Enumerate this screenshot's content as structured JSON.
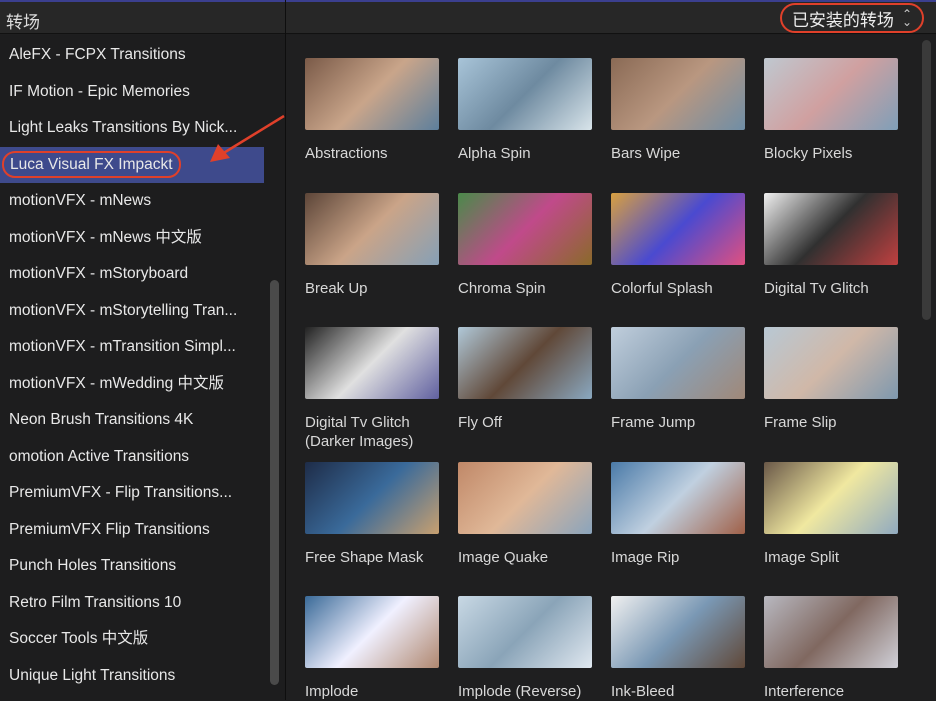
{
  "header": {
    "title": "转场",
    "filter": "已安装的转场"
  },
  "sidebar": {
    "items": [
      "AleFX - FCPX Transitions",
      "IF Motion - Epic Memories",
      "Light Leaks Transitions By Nick...",
      "Luca Visual FX Impackt",
      "motionVFX - mNews",
      "motionVFX - mNews 中文版",
      "motionVFX - mStoryboard",
      "motionVFX - mStorytelling Tran...",
      "motionVFX - mTransition Simpl...",
      "motionVFX - mWedding 中文版",
      "Neon Brush Transitions 4K",
      "omotion Active Transitions",
      "PremiumVFX - Flip Transitions...",
      "PremiumVFX Flip Transitions",
      "Punch Holes Transitions",
      "Retro Film Transitions 10",
      "Soccer Tools 中文版",
      "Unique Light Transitions"
    ],
    "selected_index": 3
  },
  "transitions": [
    {
      "name": "Abstractions",
      "colors": [
        "#7a5a48",
        "#c9a58a",
        "#5d7f9c"
      ]
    },
    {
      "name": "Alpha Spin",
      "colors": [
        "#a8c4d8",
        "#6e8aa0",
        "#d8e4ea"
      ]
    },
    {
      "name": "Bars Wipe",
      "colors": [
        "#8a6a55",
        "#b99780",
        "#6f8ea6"
      ]
    },
    {
      "name": "Blocky Pixels",
      "colors": [
        "#bfc8d0",
        "#d0a0a0",
        "#7f9fb8"
      ]
    },
    {
      "name": "Break Up",
      "colors": [
        "#5c4538",
        "#caa488",
        "#86a0b6"
      ]
    },
    {
      "name": "Chroma Spin",
      "colors": [
        "#4a8a4a",
        "#c04a8a",
        "#8a6a2a"
      ]
    },
    {
      "name": "Colorful Splash",
      "colors": [
        "#d8a040",
        "#4a4ad0",
        "#e05080"
      ]
    },
    {
      "name": "Digital Tv Glitch",
      "colors": [
        "#f0f0f0",
        "#303030",
        "#c04040"
      ]
    },
    {
      "name": "Digital Tv Glitch (Darker Images)",
      "colors": [
        "#222",
        "#e0e0e0",
        "#6060a0"
      ]
    },
    {
      "name": "Fly Off",
      "colors": [
        "#b0c8d8",
        "#604838",
        "#8aa8c0"
      ]
    },
    {
      "name": "Frame Jump",
      "colors": [
        "#c0cedc",
        "#8aa0b4",
        "#a08878"
      ]
    },
    {
      "name": "Frame Slip",
      "colors": [
        "#b8c8d4",
        "#d0b8a8",
        "#7e98ae"
      ]
    },
    {
      "name": "Free Shape Mask",
      "colors": [
        "#1e2c48",
        "#3a6a9a",
        "#c8a070"
      ]
    },
    {
      "name": "Image Quake",
      "colors": [
        "#c08868",
        "#e0b898",
        "#8aa4bc"
      ]
    },
    {
      "name": "Image Rip",
      "colors": [
        "#4a7aa8",
        "#c0d0e0",
        "#a06048"
      ]
    },
    {
      "name": "Image Split",
      "colors": [
        "#6a5848",
        "#f0e8a0",
        "#90aac0"
      ]
    },
    {
      "name": "Implode",
      "colors": [
        "#3a6a98",
        "#f0f0ff",
        "#b08870"
      ]
    },
    {
      "name": "Implode (Reverse)",
      "colors": [
        "#c8d8e4",
        "#8aa4b8",
        "#e0e8f0"
      ]
    },
    {
      "name": "Ink-Bleed",
      "colors": [
        "#f0f0f0",
        "#7a98b4",
        "#604838"
      ]
    },
    {
      "name": "Interference",
      "colors": [
        "#b8b8c0",
        "#806860",
        "#d0d0d8"
      ]
    }
  ]
}
